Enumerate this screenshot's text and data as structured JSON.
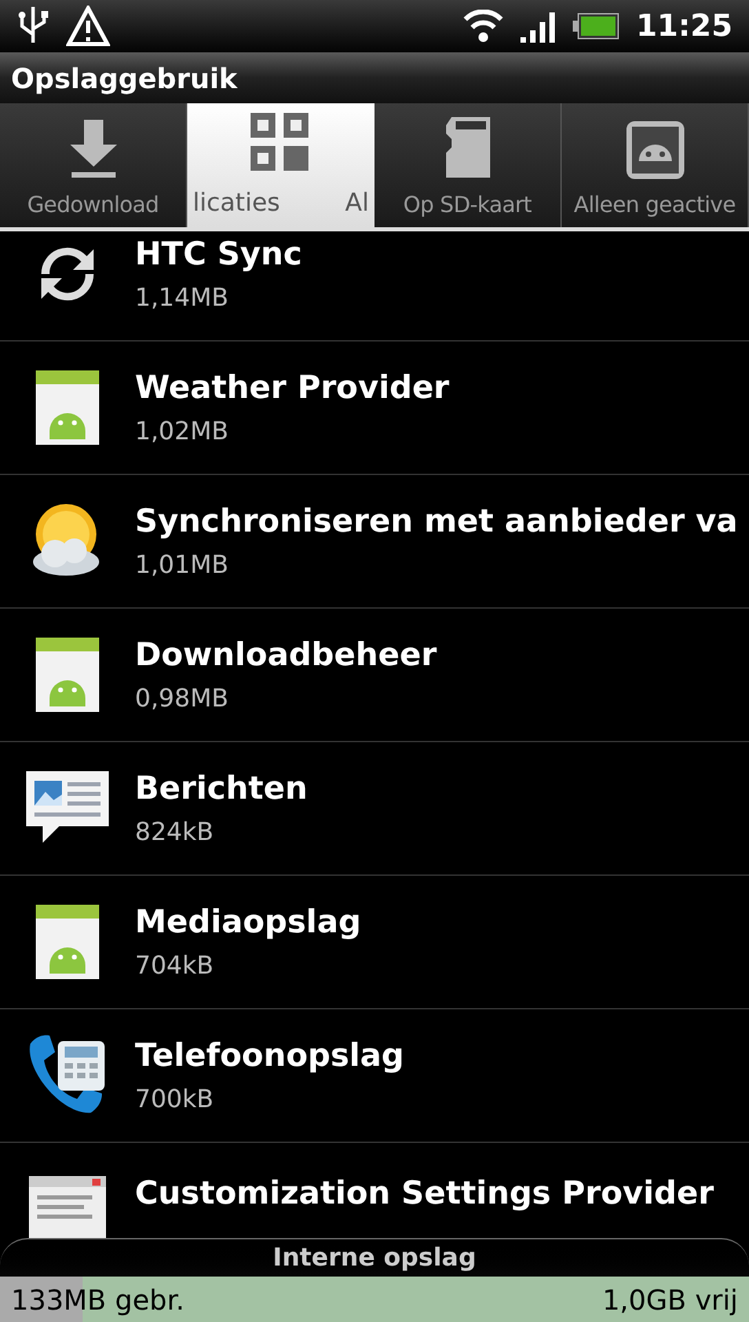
{
  "status_bar": {
    "time": "11:25"
  },
  "title": "Opslaggebruik",
  "tabs": [
    {
      "label": "Gedownload",
      "kind": "download",
      "selected": false
    },
    {
      "label": "licaties",
      "label_next": "Al",
      "kind": "grid",
      "selected": true
    },
    {
      "label": "Op SD-kaart",
      "kind": "sdcard",
      "selected": false
    },
    {
      "label": "Alleen geactive",
      "kind": "android",
      "selected": false
    }
  ],
  "apps": [
    {
      "name": "HTC Sync",
      "size": "1,14MB",
      "kind": "sync"
    },
    {
      "name": "Weather Provider",
      "size": "1,02MB",
      "kind": "android"
    },
    {
      "name": "Synchroniseren met aanbieder va",
      "size": "1,01MB",
      "kind": "weather"
    },
    {
      "name": "Downloadbeheer",
      "size": "0,98MB",
      "kind": "android"
    },
    {
      "name": "Berichten",
      "size": "824kB",
      "kind": "messages"
    },
    {
      "name": "Mediaopslag",
      "size": "704kB",
      "kind": "android"
    },
    {
      "name": "Telefoonopslag",
      "size": "700kB",
      "kind": "phone"
    },
    {
      "name": "Customization Settings Provider",
      "kind": "settings"
    }
  ],
  "storage": {
    "title": "Interne opslag",
    "used": "133MB gebr.",
    "free": "1,0GB vrij",
    "level": 0.11
  }
}
